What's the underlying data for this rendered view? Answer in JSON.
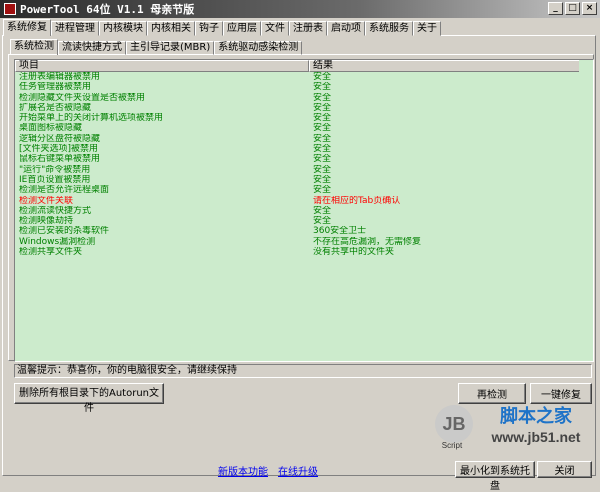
{
  "window": {
    "title": "PowerTool 64位 V1.1 母亲节版",
    "buttons": [
      "_",
      "□",
      "×"
    ]
  },
  "main_tabs": [
    "系统修复",
    "进程管理",
    "内核模块",
    "内核相关",
    "钩子",
    "应用层",
    "文件",
    "注册表",
    "启动项",
    "系统服务",
    "关于"
  ],
  "sub_tabs": [
    "系统检测",
    "流读快捷方式",
    "主引导记录(MBR)",
    "系统驱动感染检测"
  ],
  "table": {
    "columns": [
      "项目",
      "结果"
    ],
    "rows": [
      {
        "item": "注册表编辑器被禁用",
        "result": "安全",
        "status": "ok"
      },
      {
        "item": "任务管理器被禁用",
        "result": "安全",
        "status": "ok"
      },
      {
        "item": "检测隐藏文件夹设置是否被禁用",
        "result": "安全",
        "status": "ok"
      },
      {
        "item": "扩展名是否被隐藏",
        "result": "安全",
        "status": "ok"
      },
      {
        "item": "开始菜单上的关闭计算机选项被禁用",
        "result": "安全",
        "status": "ok"
      },
      {
        "item": "桌面图标被隐藏",
        "result": "安全",
        "status": "ok"
      },
      {
        "item": "逻辑分区盘符被隐藏",
        "result": "安全",
        "status": "ok"
      },
      {
        "item": "[文件夹选项]被禁用",
        "result": "安全",
        "status": "ok"
      },
      {
        "item": "鼠标右键菜单被禁用",
        "result": "安全",
        "status": "ok"
      },
      {
        "item": "\"运行\"命令被禁用",
        "result": "安全",
        "status": "ok"
      },
      {
        "item": "IE首页设置被禁用",
        "result": "安全",
        "status": "ok"
      },
      {
        "item": "检测是否允许远程桌面",
        "result": "安全",
        "status": "ok"
      },
      {
        "item": "检测文件关联",
        "result": "请在相应的Tab页确认",
        "status": "warn"
      },
      {
        "item": "检测流读快捷方式",
        "result": "安全",
        "status": "ok"
      },
      {
        "item": "检测映像劫持",
        "result": "安全",
        "status": "ok"
      },
      {
        "item": "检测已安装的杀毒软件",
        "result": "360安全卫士",
        "status": "ok"
      },
      {
        "item": "Windows漏洞检测",
        "result": "不存在高危漏洞，无需修复",
        "status": "ok"
      },
      {
        "item": "检测共享文件夹",
        "result": "没有共享中的文件夹",
        "status": "ok"
      }
    ]
  },
  "status_text": "温馨提示：恭喜你，你的电脑很安全，请继续保持",
  "buttons": {
    "delete_autorun": "删除所有根目录下的Autorun文件",
    "recheck": "再检测",
    "one_click_fix": "一键修复",
    "minimize_tray": "最小化到系统托盘",
    "close": "关闭"
  },
  "links": {
    "new_features": "新版本功能",
    "online_upgrade": "在线升级"
  },
  "watermark": {
    "logo": "JB",
    "script": "Script",
    "brand": "脚本之家",
    "url": "www.jb51.net"
  },
  "colors": {
    "ok": "#008000",
    "warn": "#ff0000",
    "list_bg": "#ccebcc"
  }
}
